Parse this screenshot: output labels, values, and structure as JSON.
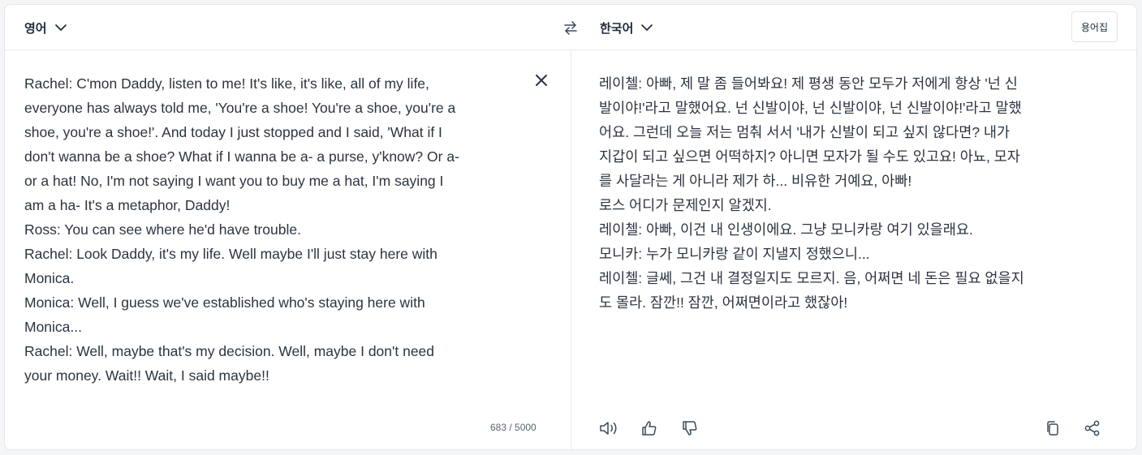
{
  "header": {
    "source_language": "영어",
    "target_language": "한국어",
    "glossary_label": "용어집"
  },
  "source": {
    "text": "Rachel: C'mon Daddy, listen to me! It's like, it's like, all of my life,\neveryone has always told me, 'You're a shoe! You're a shoe, you're a\nshoe, you're a shoe!'. And today I just stopped and I said, 'What if I\ndon't wanna be a shoe? What if I wanna be a- a purse, y'know? Or a-\nor a hat! No, I'm not saying I want you to buy me a hat, I'm saying I\nam a ha- It's a metaphor, Daddy!\nRoss: You can see where he'd have trouble.\nRachel: Look Daddy, it's my life. Well maybe I'll just stay here with\nMonica.\nMonica: Well, I guess we've established who's staying here with\nMonica...\nRachel: Well, maybe that's my decision. Well, maybe I don't need\nyour money. Wait!! Wait, I said maybe!!",
    "char_count": "683 / 5000"
  },
  "target": {
    "text": "레이첼: 아빠, 제 말 좀 들어봐요! 제 평생 동안 모두가 저에게 항상 '넌 신\n발이야!'라고 말했어요. 넌 신발이야, 넌 신발이야, 넌 신발이야!'라고 말했\n어요. 그런데 오늘 저는 멈춰 서서 '내가 신발이 되고 싶지 않다면? 내가\n지갑이 되고 싶으면 어떡하지? 아니면 모자가 될 수도 있고요! 아뇨, 모자\n를 사달라는 게 아니라 제가 하... 비유한 거예요, 아빠!\n로스 어디가 문제인지 알겠지.\n레이첼: 아빠, 이건 내 인생이에요. 그냥 모니카랑 여기 있을래요.\n모니카: 누가 모니카랑 같이 지낼지 정했으니...\n레이첼: 글쎄, 그건 내 결정일지도 모르지. 음, 어쩌면 네 돈은 필요 없을지\n도 몰라. 잠깐!! 잠깐, 어쩌면이라고 했잖아!"
  },
  "icons": {
    "source_chevron": "chevron-down-icon",
    "target_chevron": "chevron-down-icon",
    "swap": "swap-arrows-icon",
    "clear": "close-icon",
    "listen": "speaker-icon",
    "like": "thumbs-up-icon",
    "dislike": "thumbs-down-icon",
    "copy": "copy-icon",
    "share": "share-icon"
  },
  "colors": {
    "text": "#2b3440",
    "heading": "#1b2a3a",
    "border": "#e6e9ee",
    "background": "#f3f5f7"
  }
}
